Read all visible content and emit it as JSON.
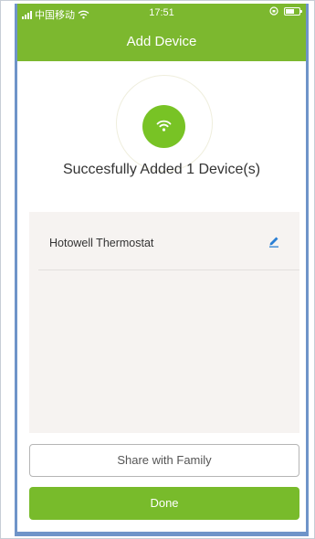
{
  "status_bar": {
    "carrier": "中国移动",
    "time": "17:51",
    "icons": [
      "signal-icon",
      "wifi-icon",
      "orientation-lock-icon",
      "battery-icon"
    ]
  },
  "header": {
    "title": "Add Device"
  },
  "result": {
    "message": "Succesfully Added 1 Device(s)",
    "icon": "wifi-icon"
  },
  "devices": [
    {
      "name": "Hotowell Thermostat",
      "action_icon": "edit-icon"
    }
  ],
  "buttons": {
    "share": "Share with Family",
    "done": "Done"
  },
  "colors": {
    "brand_green": "#7cb82f",
    "icon_green": "#78c325",
    "edit_blue": "#2a7fd4",
    "list_bg": "#f6f3f1"
  }
}
